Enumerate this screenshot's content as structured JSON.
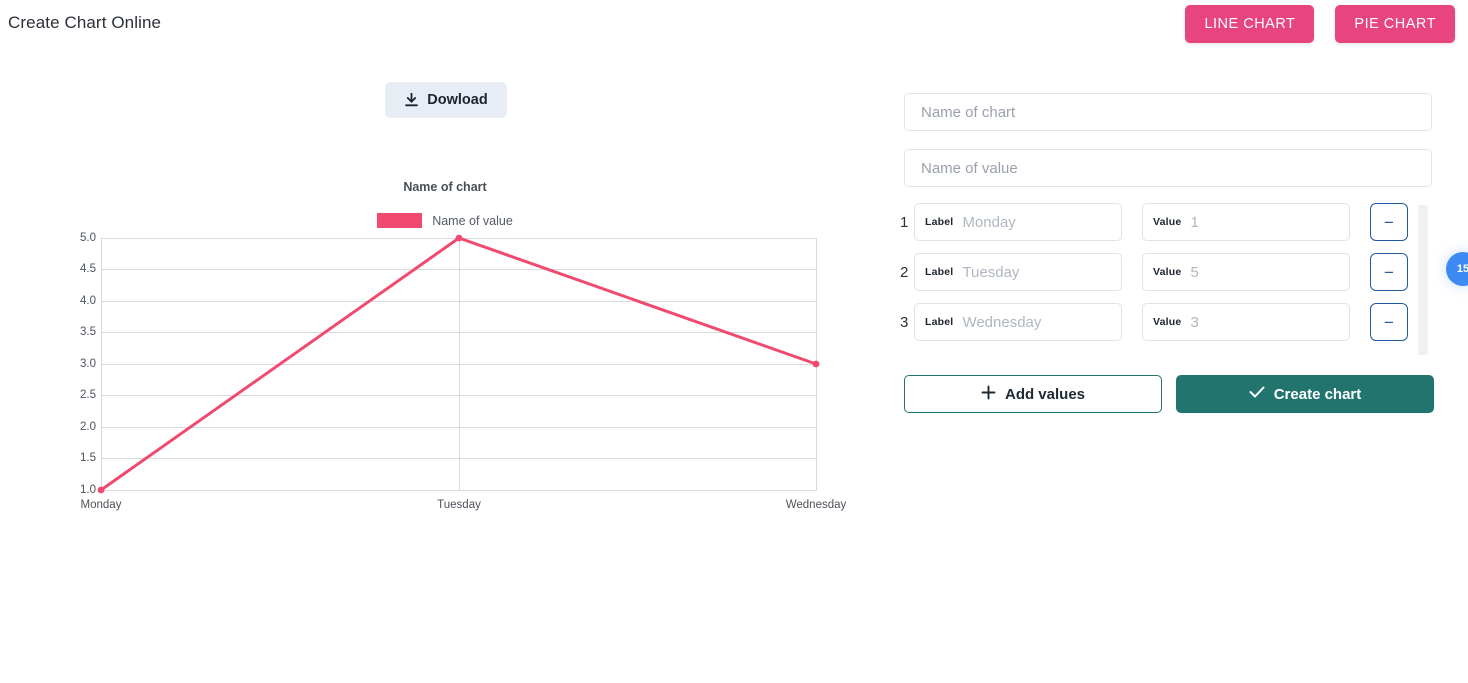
{
  "header": {
    "title": "Create Chart Online",
    "buttons": [
      {
        "label": "LINE CHART",
        "name": "line-chart-button"
      },
      {
        "label": "PIE CHART",
        "name": "pie-chart-button"
      }
    ],
    "accent_pink": "#e8447f"
  },
  "toolbar": {
    "download_label": "Dowload"
  },
  "chart_data": {
    "type": "line",
    "title": "Name of chart",
    "categories": [
      "Monday",
      "Tuesday",
      "Wednesday"
    ],
    "values": [
      1,
      5,
      3
    ],
    "series": [
      {
        "name": "Name of value",
        "values": [
          1,
          5,
          3
        ],
        "color": "#f04a70"
      }
    ],
    "legend": {
      "entries": [
        "Name of value"
      ],
      "position": "top"
    },
    "xlabel": "",
    "ylabel": "",
    "ylim": [
      1.0,
      5.0
    ],
    "yticks": [
      "5.0",
      "4.5",
      "4.0",
      "3.5",
      "3.0",
      "2.5",
      "2.0",
      "1.5",
      "1.0"
    ],
    "xticks": [
      "Monday",
      "Tuesday",
      "Wednesday"
    ],
    "grid": true,
    "line_color": "#f04a70"
  },
  "form": {
    "chart_name": {
      "value": "",
      "placeholder": "Name of chart"
    },
    "value_name": {
      "value": "",
      "placeholder": "Name of value"
    },
    "field_labels": {
      "label": "Label",
      "value": "Value"
    },
    "remove_label": "−",
    "rows": [
      {
        "index": "1",
        "label_value": "",
        "label_placeholder": "Monday",
        "value_value": "",
        "value_placeholder": "1"
      },
      {
        "index": "2",
        "label_value": "",
        "label_placeholder": "Tuesday",
        "value_value": "",
        "value_placeholder": "5"
      },
      {
        "index": "3",
        "label_value": "",
        "label_placeholder": "Wednesday",
        "value_value": "",
        "value_placeholder": "3"
      }
    ],
    "add_values_label": "Add values",
    "create_chart_label": "Create chart"
  },
  "widgets": {
    "side_badge_label": "15"
  }
}
